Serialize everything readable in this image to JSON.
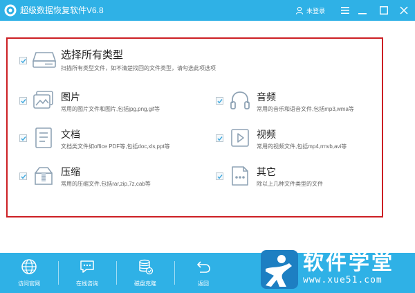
{
  "app": {
    "title": "超级数据恢复软件V6.8",
    "user_label": "未登录"
  },
  "colors": {
    "accent": "#2fb1e6",
    "highlight_border": "#cc1f24",
    "icon_gray": "#8fa3b5",
    "check_blue": "#3ba6dd"
  },
  "options": {
    "all": {
      "title": "选择所有类型",
      "desc": "扫描所有类型文件，如不清楚找回的文件类型，请勾选此项选项",
      "checked": true,
      "icon": "drive-icon"
    },
    "images": {
      "title": "图片",
      "desc": "常用的图片文件和图片,包括jpg,png,gif等",
      "checked": true,
      "icon": "picture-icon"
    },
    "audio": {
      "title": "音频",
      "desc": "常用的音乐和语音文件,包括mp3,wma等",
      "checked": true,
      "icon": "headphones-icon"
    },
    "docs": {
      "title": "文档",
      "desc": "文档类文件如office PDF等,包括doc,xls,ppt等",
      "checked": true,
      "icon": "document-icon"
    },
    "video": {
      "title": "视频",
      "desc": "常用的视频文件,包括mp4,rmvb,avi等",
      "checked": true,
      "icon": "video-icon"
    },
    "archive": {
      "title": "压缩",
      "desc": "常用的压缩文件,包括rar,zip,7z,cab等",
      "checked": true,
      "icon": "archive-icon"
    },
    "other": {
      "title": "其它",
      "desc": "除以上几种文件类型的文件",
      "checked": true,
      "icon": "other-file-icon"
    }
  },
  "bottom_nav": [
    {
      "label": "访问官网",
      "icon": "globe-icon"
    },
    {
      "label": "在线咨询",
      "icon": "chat-icon"
    },
    {
      "label": "磁盘克隆",
      "icon": "disk-clone-icon"
    },
    {
      "label": "返回",
      "icon": "return-icon"
    }
  ],
  "watermark": {
    "text": "软件学堂",
    "url": "www.xue51.com"
  }
}
